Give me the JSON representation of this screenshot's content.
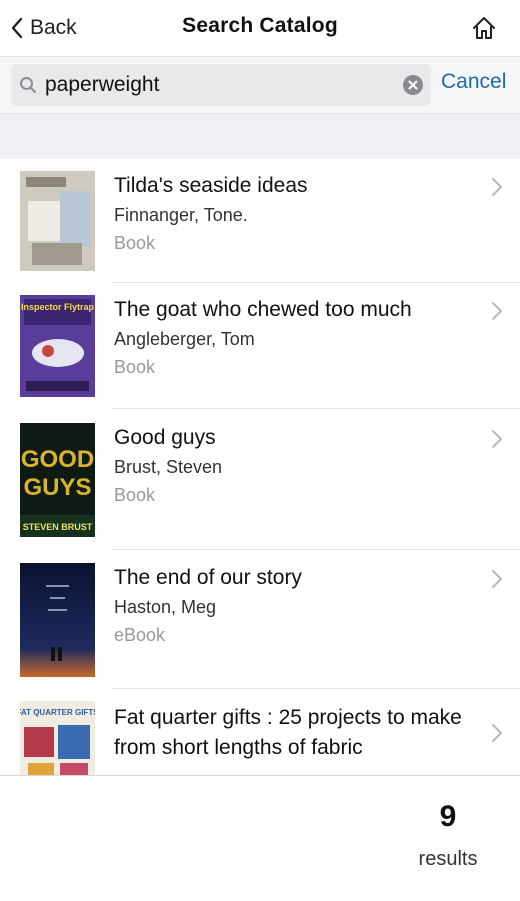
{
  "nav": {
    "back_label": "Back",
    "title": "Search Catalog"
  },
  "search": {
    "query": "paperweight",
    "cancel_label": "Cancel"
  },
  "results": [
    {
      "title": "Tilda's seaside ideas",
      "author": "Finnanger, Tone.",
      "format": "Book"
    },
    {
      "title": "The goat who chewed too much",
      "author": "Angleberger, Tom",
      "format": "Book"
    },
    {
      "title": "Good guys",
      "author": "Brust, Steven",
      "format": "Book"
    },
    {
      "title": "The end of our story",
      "author": "Haston, Meg",
      "format": "eBook"
    },
    {
      "title": "Fat quarter gifts : 25 projects to make from short lengths of fabric",
      "author": "",
      "format": ""
    }
  ],
  "covers": {
    "0": {
      "text": ""
    },
    "1": {
      "text": "Inspector Flytrap"
    },
    "2": {
      "text1": "GOOD",
      "text2": "GUYS",
      "text3": "STEVEN BRUST"
    },
    "3": {
      "text": ""
    },
    "4": {
      "text": "FAT QUARTER GIFTS"
    }
  },
  "footer": {
    "count": "9",
    "label": "results"
  },
  "colors": {
    "accent": "#1c6ca8",
    "divider": "#e4e4e4",
    "muted": "#999999"
  }
}
